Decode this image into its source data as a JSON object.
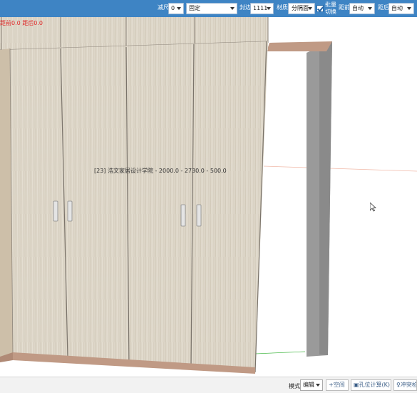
{
  "toolbar": {
    "scale_label": "减尺",
    "scale_value": "0",
    "mode_value": "固定",
    "edge_label": "封边",
    "edge_value": "1111",
    "material_label": "材质",
    "material_value": "分隔面",
    "batch_line1": "批量",
    "batch_line2": "切换",
    "spacing_label1": "距前",
    "spacing_value1": "自动",
    "spacing_label2": "距后",
    "spacing_value2": "自动"
  },
  "viewport": {
    "status_text": "距前0.0 距后0.0",
    "dimension_text": "[23] 浩文家居设计学院 - 2000.0 - 2730.0 - 500.0"
  },
  "bottombar": {
    "mode_label": "模式",
    "mode_value": "编辑",
    "space_button": "空间",
    "hole_button": "孔位计算(K)",
    "conflict_button": "冲突检"
  },
  "colors": {
    "toolbar_bg": "#3e84c4",
    "wood": "#ddd6c8",
    "edge": "#c09a85"
  }
}
